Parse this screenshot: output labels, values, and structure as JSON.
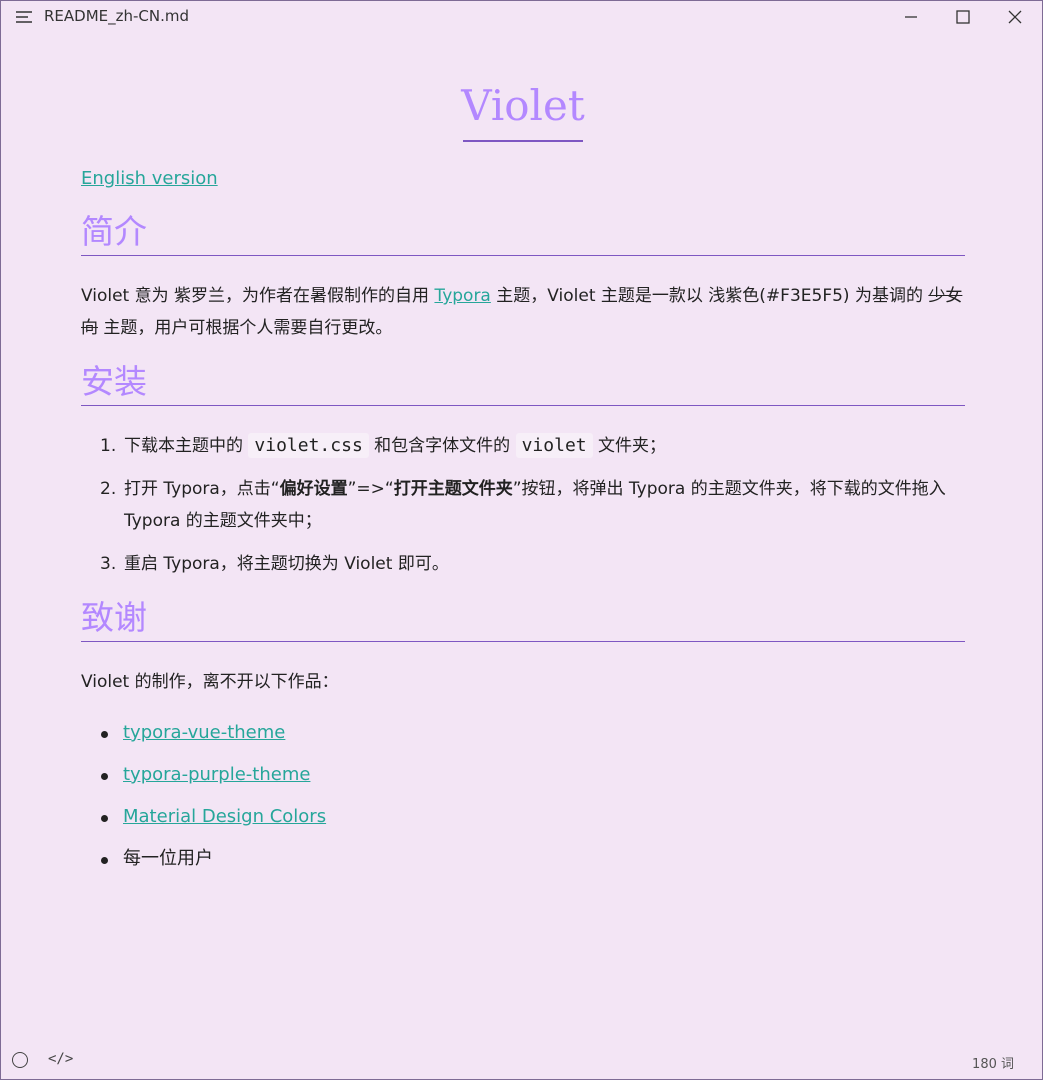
{
  "window": {
    "title": "README_zh-CN.md",
    "controls": {
      "minimize_icon": "minimize-icon",
      "maximize_icon": "maximize-icon",
      "close_icon": "close-icon"
    }
  },
  "doc": {
    "h1": "Violet",
    "english_link": "English version",
    "sections": [
      {
        "title": "简介"
      },
      {
        "title": "安装"
      },
      {
        "title": "致谢"
      }
    ],
    "intro": {
      "p1_a": "Violet 意为 紫罗兰，为作者在暑假制作的自用 ",
      "p1_link": "Typora",
      "p1_b": " 主题，Violet 主题是一款以 浅紫色(#F3E5F5) 为基调的 ",
      "p1_strike": "少女向",
      "p1_c": " 主题，用户可根据个人需要自行更改。"
    },
    "install": [
      {
        "num": "1.",
        "a": "下载本主题中的 ",
        "code1": "violet.css",
        "b": " 和包含字体文件的 ",
        "code2": "violet",
        "c": " 文件夹；"
      },
      {
        "num": "2.",
        "a": "打开 Typora，点击“",
        "bold1": "偏好设置",
        "b": "”=>“",
        "bold2": "打开主题文件夹",
        "c": "”按钮，将弹出 Typora 的主题文件夹，将下载的文件拖入 Typora 的主题文件夹中；"
      },
      {
        "num": "3.",
        "a": "重启 Typora，将主题切换为 Violet 即可。"
      }
    ],
    "thanks_intro": "Violet 的制作，离不开以下作品：",
    "thanks": [
      {
        "text": "typora-vue-theme",
        "link": true
      },
      {
        "text": "typora-purple-theme",
        "link": true
      },
      {
        "text": "Material Design Colors",
        "link": true
      },
      {
        "text": "每一位用户",
        "link": false
      }
    ]
  },
  "footer": {
    "word_count": "180 词",
    "left_icons": [
      "outline-toggle-icon",
      "source-code-icon"
    ]
  },
  "colors": {
    "background": "#f3e5f5",
    "heading": "#b388ff",
    "rule": "#7e57c2",
    "link": "#26a69a"
  }
}
